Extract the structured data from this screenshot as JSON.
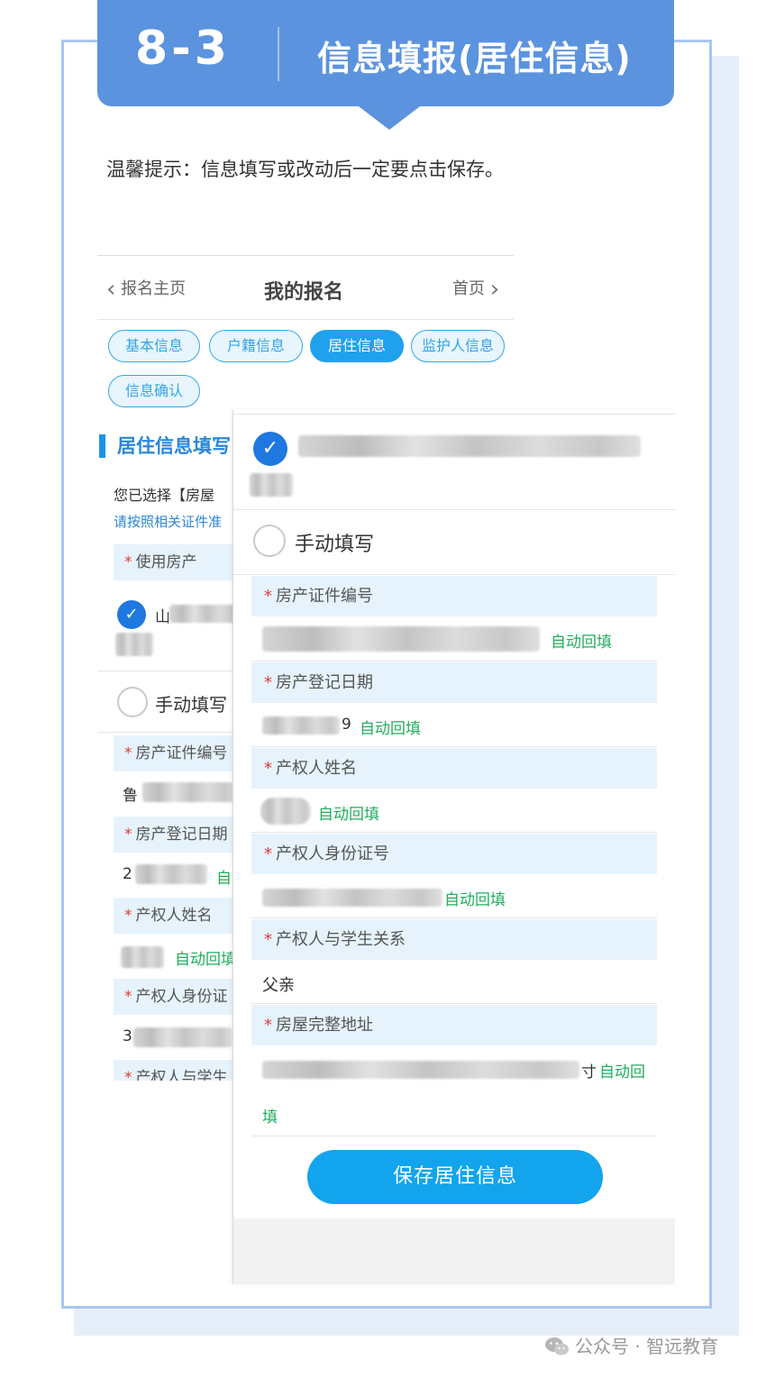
{
  "header": {
    "step": "8-3",
    "title": "信息填报(居住信息)"
  },
  "tip": "温馨提示：信息填写或改动后一定要点击保存。",
  "screen1": {
    "nav": {
      "back": "报名主页",
      "title": "我的报名",
      "home": "首页"
    },
    "tabs": [
      "基本信息",
      "户籍信息",
      "居住信息",
      "监护人信息",
      "信息确认"
    ],
    "active_tab": "居住信息",
    "section_title": "居住信息填写",
    "hint_selected": "您已选择【房屋",
    "hint_certificate": "请按照相关证件准",
    "use_property_label": "使用房产",
    "property_option_prefix": "山",
    "manual_option": "手动填写",
    "fields": [
      {
        "label": "房产证件编号",
        "value_prefix": "鲁",
        "autofill": ""
      },
      {
        "label": "房产登记日期",
        "value_prefix": "2",
        "autofill": "自"
      },
      {
        "label": "产权人姓名",
        "value_prefix": "",
        "autofill": "自动回填"
      },
      {
        "label": "产权人身份证",
        "value_prefix": "3",
        "autofill": ""
      },
      {
        "label": "产权人与学生",
        "value_prefix": "",
        "autofill": ""
      }
    ]
  },
  "screen2": {
    "manual_option": "手动填写",
    "fields": [
      {
        "label": "房产证件编号",
        "value": "",
        "autofill": "自动回填"
      },
      {
        "label": "房产登记日期",
        "value": "9",
        "autofill": "自动回填"
      },
      {
        "label": "产权人姓名",
        "value": "",
        "autofill": "自动回填"
      },
      {
        "label": "产权人身份证号",
        "value": "",
        "autofill": "自动回填"
      },
      {
        "label": "产权人与学生关系",
        "value": "父亲",
        "autofill": ""
      },
      {
        "label": "房屋完整地址",
        "value": "寸",
        "autofill": "自动回",
        "autofill_wrap": "填"
      }
    ],
    "save_button": "保存居住信息"
  },
  "watermark": "公众号 · 智远教育",
  "colors": {
    "header": "#5b93df",
    "accent": "#12a4ec",
    "autofill": "#1fae5b",
    "required": "#e23b3b",
    "label_bg": "#e6f3fc"
  }
}
